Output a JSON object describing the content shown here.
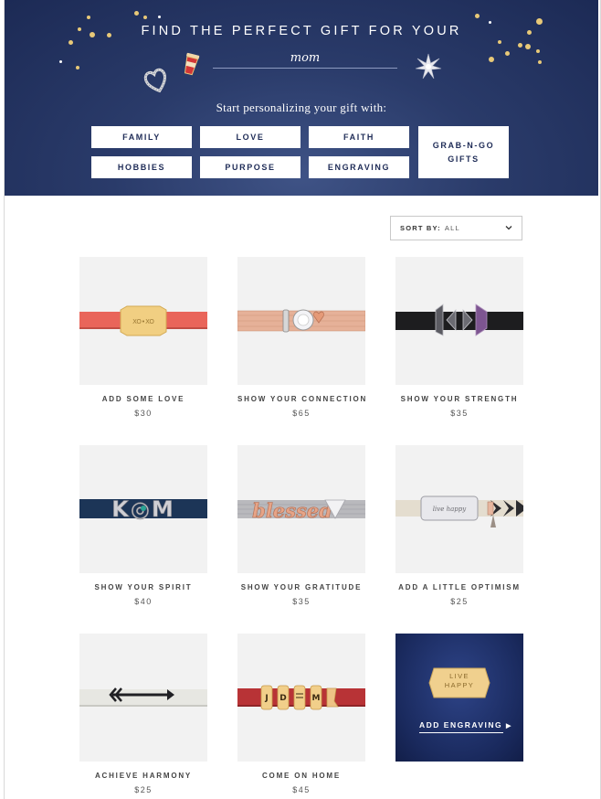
{
  "hero": {
    "title": "FIND THE PERFECT GIFT FOR YOUR",
    "recipient": "mom",
    "subtitle": "Start personalizing your gift with:",
    "categories": [
      "FAMILY",
      "LOVE",
      "FAITH",
      "HOBBIES",
      "PURPOSE",
      "ENGRAVING"
    ],
    "grab_n_go": {
      "line1": "GRAB-N-GO",
      "line2": "GIFTS"
    }
  },
  "sort": {
    "label": "SORT BY:",
    "value": "ALL"
  },
  "products": [
    {
      "name": "ADD SOME LOVE",
      "price": "$30"
    },
    {
      "name": "SHOW YOUR CONNECTION",
      "price": "$65"
    },
    {
      "name": "SHOW YOUR STRENGTH",
      "price": "$35"
    },
    {
      "name": "SHOW YOUR SPIRIT",
      "price": "$40"
    },
    {
      "name": "SHOW YOUR GRATITUDE",
      "price": "$35"
    },
    {
      "name": "ADD A LITTLE OPTIMISM",
      "price": "$25"
    },
    {
      "name": "ACHIEVE HARMONY",
      "price": "$25"
    },
    {
      "name": "COME ON HOME",
      "price": "$45"
    }
  ],
  "product_text": {
    "love_plate": "XO•XO",
    "spirit_letters": "K◎M",
    "gratitude_script": "blessed",
    "optimism_plate": "live happy",
    "come_home_charms": [
      "J",
      "D",
      "M"
    ]
  },
  "promo": {
    "plate_line1": "LIVE",
    "plate_line2": "HAPPY",
    "link": "ADD ENGRAVING"
  },
  "colors": {
    "navy": "#1f2c57",
    "gold": "#e8c978",
    "coral": "#e9655a",
    "rose_gold": "#e2a98c",
    "red_band": "#b83336"
  }
}
